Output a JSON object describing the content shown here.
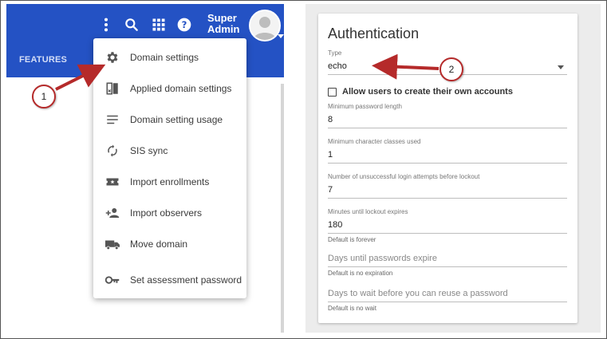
{
  "header": {
    "features_label": "FEATURES",
    "user_name_line1": "Super",
    "user_name_line2": "Admin"
  },
  "menu": {
    "items": [
      {
        "label": "Domain settings",
        "icon": "gear-icon"
      },
      {
        "label": "Applied domain settings",
        "icon": "split-book-icon"
      },
      {
        "label": "Domain setting usage",
        "icon": "list-icon"
      },
      {
        "label": "SIS sync",
        "icon": "sync-icon"
      },
      {
        "label": "Import enrollments",
        "icon": "ticket-icon"
      },
      {
        "label": "Import observers",
        "icon": "person-add-icon"
      },
      {
        "label": "Move domain",
        "icon": "truck-icon"
      },
      {
        "label": "Set assessment password",
        "icon": "key-icon"
      }
    ]
  },
  "auth": {
    "title": "Authentication",
    "type_label": "Type",
    "type_value": "echo",
    "allow_create_label": "Allow users to create their own accounts",
    "min_password_label": "Minimum password length",
    "min_password_value": "8",
    "min_char_classes_label": "Minimum character classes used",
    "min_char_classes_value": "1",
    "attempts_label": "Number of unsuccessful login attempts before lockout",
    "attempts_value": "7",
    "lockout_label": "Minutes until lockout expires",
    "lockout_value": "180",
    "lockout_help": "Default is forever",
    "expire_placeholder": "Days until passwords expire",
    "expire_help": "Default is no expiration",
    "reuse_placeholder": "Days to wait before you can reuse a password",
    "reuse_help": "Default is no wait"
  },
  "annotations": {
    "badge1": "1",
    "badge2": "2"
  },
  "colors": {
    "header_blue": "#2452c4",
    "annotation_red": "#b52a2a"
  }
}
